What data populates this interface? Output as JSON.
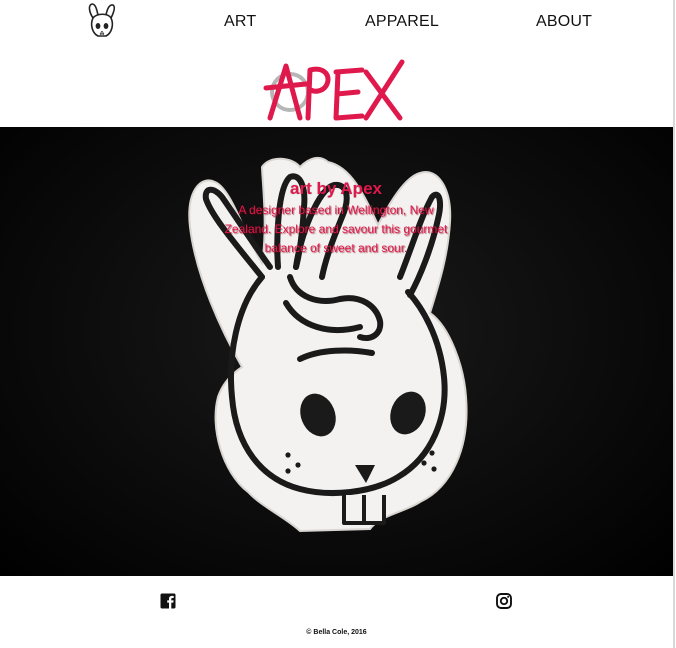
{
  "nav": {
    "logo_icon": "bunny-logo-icon",
    "links": [
      "ART",
      "APPAREL",
      "ABOUT"
    ]
  },
  "brand": {
    "wordmark": "APEX",
    "accent_color": "#e0194d"
  },
  "hero": {
    "title": "art by Apex",
    "description": "A designer based in Wellington, New Zealand. Explore and savour this gourmet balance of sweet and sour."
  },
  "footer": {
    "icons": [
      "facebook-icon",
      "instagram-icon"
    ],
    "copyright": "© Bella Cole, 2016"
  }
}
